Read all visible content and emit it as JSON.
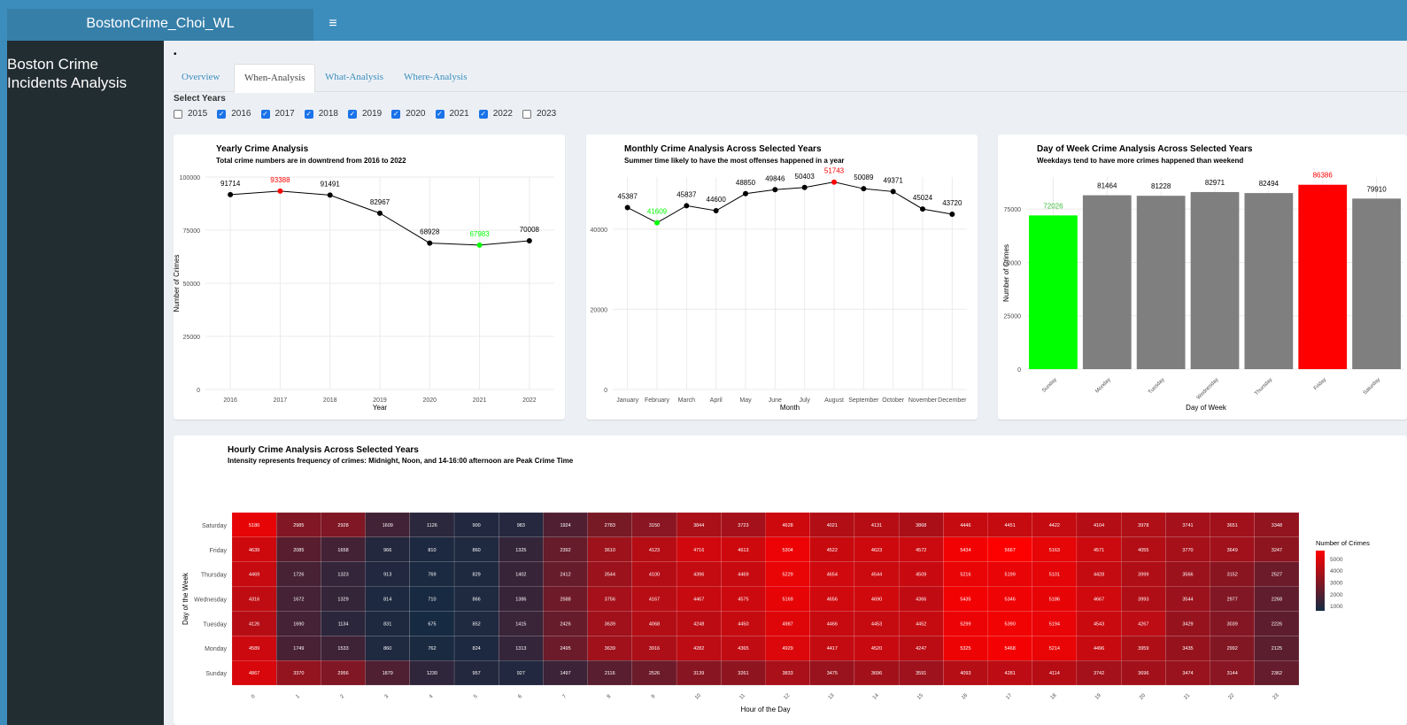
{
  "app": {
    "title": "BostonCrime_Choi_WL",
    "menu_icon": "hamburger-icon",
    "toggle_glyph": "≡"
  },
  "sidebar": {
    "title_line1": "Boston Crime",
    "title_line2": "Incidents Analysis"
  },
  "bullet": "•",
  "tabs": [
    {
      "label": "Overview",
      "active": false
    },
    {
      "label": "When-Analysis",
      "active": true
    },
    {
      "label": "What-Analysis",
      "active": false
    },
    {
      "label": "Where-Analysis",
      "active": false
    }
  ],
  "year_filter": {
    "label": "Select Years",
    "options": [
      {
        "label": "2015",
        "checked": false
      },
      {
        "label": "2016",
        "checked": true
      },
      {
        "label": "2017",
        "checked": true
      },
      {
        "label": "2018",
        "checked": true
      },
      {
        "label": "2019",
        "checked": true
      },
      {
        "label": "2020",
        "checked": true
      },
      {
        "label": "2021",
        "checked": true
      },
      {
        "label": "2022",
        "checked": true
      },
      {
        "label": "2023",
        "checked": false
      }
    ]
  },
  "colors": {
    "header": "#3c8dbc",
    "logo": "#367fa9",
    "sidebar": "#222d32",
    "content_bg": "#ecf0f5",
    "highlight_high": "#ff0000",
    "highlight_low": "#00ff00",
    "bar_default": "#7f7f7f"
  },
  "chart_data": [
    {
      "type": "line",
      "title": "Yearly Crime Analysis",
      "subtitle": "Total crime numbers are in downtrend from 2016 to 2022",
      "xlabel": "Year",
      "ylabel": "Number of Crimes",
      "x": [
        "2016",
        "2017",
        "2018",
        "2019",
        "2020",
        "2021",
        "2022"
      ],
      "values": [
        91714,
        93388,
        91491,
        82967,
        68928,
        67983,
        70008
      ],
      "highlight_max": "2017",
      "highlight_min": "2021",
      "ylim": [
        0,
        100000
      ],
      "yticks": [
        0,
        25000,
        50000,
        75000,
        100000
      ],
      "grid": true
    },
    {
      "type": "line",
      "title": "Monthly Crime Analysis Across Selected Years",
      "subtitle": "Summer time likely to have the most offenses happened in a year",
      "xlabel": "Month",
      "ylabel": "Number of Crimes",
      "x": [
        "January",
        "February",
        "March",
        "April",
        "May",
        "June",
        "July",
        "August",
        "September",
        "October",
        "November",
        "December"
      ],
      "values": [
        45387,
        41609,
        45837,
        44600,
        48850,
        49846,
        50403,
        51743,
        50089,
        49371,
        45024,
        43720
      ],
      "highlight_max": "August",
      "highlight_min": "February",
      "ylim": [
        0,
        53000
      ],
      "yticks": [
        0,
        20000,
        40000
      ],
      "grid": true
    },
    {
      "type": "bar",
      "title": "Day of Week Crime Analysis Across Selected Years",
      "subtitle": "Weekdays tend to have more crimes happened than weekend",
      "xlabel": "Day of Week",
      "ylabel": "Number of Crimes",
      "categories": [
        "Sunday",
        "Monday",
        "Tuesday",
        "Wednesday",
        "Thursday",
        "Friday",
        "Saturday"
      ],
      "values": [
        72026,
        81464,
        81228,
        82971,
        82494,
        86386,
        79910
      ],
      "highlight_max": "Friday",
      "highlight_min": "Sunday",
      "ylim": [
        0,
        90000
      ],
      "yticks": [
        0,
        25000,
        50000,
        75000
      ],
      "grid": true
    },
    {
      "type": "heatmap",
      "title": "Hourly Crime Analysis Across Selected Years",
      "subtitle": "Intensity represents frequency of crimes: Midnight, Noon, and 14-16:00 afternoon are Peak Crime Time",
      "xlabel": "Hour of the Day",
      "ylabel": "Day of the Week",
      "x": [
        "0",
        "1",
        "2",
        "3",
        "4",
        "5",
        "6",
        "7",
        "8",
        "9",
        "10",
        "11",
        "12",
        "13",
        "14",
        "15",
        "16",
        "17",
        "18",
        "19",
        "20",
        "21",
        "22",
        "23"
      ],
      "y": [
        "Saturday",
        "Friday",
        "Thursday",
        "Wednesday",
        "Tuesday",
        "Monday",
        "Sunday"
      ],
      "values": [
        [
          5180,
          2985,
          2928,
          1609,
          1126,
          900,
          983,
          1924,
          2783,
          3150,
          3844,
          3723,
          4628,
          4021,
          4131,
          3868,
          4446,
          4451,
          4422,
          4104,
          3978,
          3741,
          3651,
          3348
        ],
        [
          4639,
          2085,
          1658,
          966,
          810,
          860,
          1325,
          2392,
          3610,
          4123,
          4716,
          4613,
          5304,
          4522,
          4623,
          4572,
          5434,
          5667,
          5163,
          4571,
          4055,
          3770,
          3649,
          3247
        ],
        [
          4469,
          1726,
          1323,
          913,
          769,
          829,
          1402,
          2412,
          3544,
          4100,
          4396,
          4469,
          5229,
          4654,
          4544,
          4509,
          5216,
          5199,
          5101,
          4428,
          3999,
          3566,
          3152,
          2527
        ],
        [
          4316,
          1672,
          1329,
          814,
          710,
          866,
          1386,
          2588,
          3756,
          4167,
          4467,
          4575,
          5169,
          4656,
          4690,
          4366,
          5435,
          5346,
          5186,
          4667,
          3993,
          3544,
          2977,
          2268
        ],
        [
          4126,
          1690,
          1134,
          831,
          675,
          852,
          1415,
          2426,
          3639,
          4068,
          4248,
          4450,
          4987,
          4466,
          4453,
          4452,
          5299,
          5390,
          5194,
          4543,
          4267,
          3429,
          3039,
          2226
        ],
        [
          4589,
          1749,
          1533,
          860,
          762,
          824,
          1313,
          2495,
          3639,
          3916,
          4282,
          4365,
          4929,
          4417,
          4520,
          4247,
          5325,
          5468,
          5214,
          4496,
          3959,
          3435,
          2992,
          2125
        ],
        [
          4867,
          3370,
          2956,
          1879,
          1230,
          957,
          927,
          1497,
          2116,
          2526,
          3139,
          3261,
          3833,
          3475,
          3696,
          3591,
          4093,
          4281,
          4114,
          3742,
          3696,
          3474,
          3144,
          2362
        ]
      ],
      "legend_title": "Number of Crimes",
      "legend_ticks": [
        "5000",
        "4000",
        "3000",
        "2000",
        "1000"
      ],
      "color_low": "#132b43",
      "color_high": "#ff0000"
    }
  ]
}
